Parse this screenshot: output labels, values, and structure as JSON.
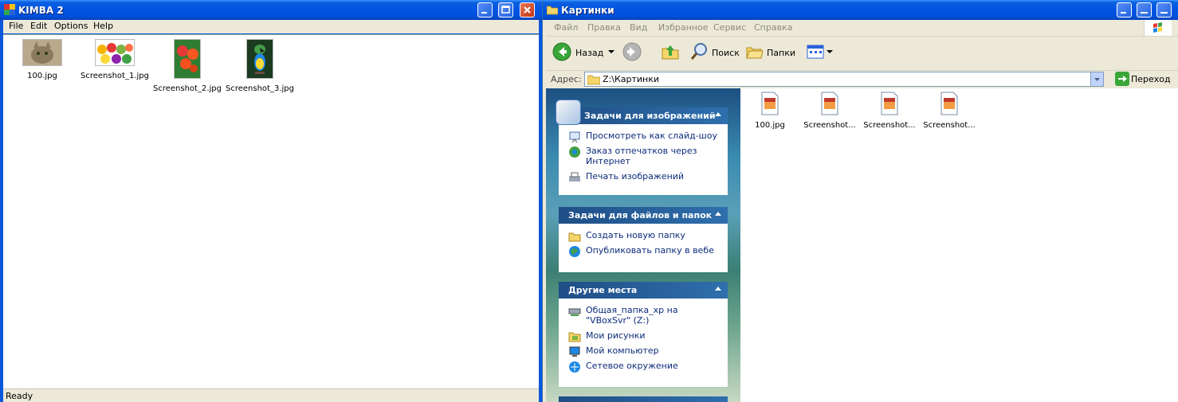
{
  "kimba": {
    "title": "KIMBA 2",
    "menu": [
      "File",
      "Edit",
      "Options",
      "Help"
    ],
    "thumbnails": [
      {
        "label": "100.jpg",
        "icon": "cat-photo"
      },
      {
        "label": "Screenshot_1.jpg",
        "icon": "fruit-photo"
      },
      {
        "label": "Screenshot_2.jpg",
        "icon": "flowers-photo"
      },
      {
        "label": "Screenshot_3.jpg",
        "icon": "parrot-photo"
      }
    ],
    "status": "Ready"
  },
  "explorer": {
    "title": "Картинки",
    "menu": [
      "Файл",
      "Правка",
      "Вид",
      "Избранное",
      "Сервис",
      "Справка"
    ],
    "toolbar": {
      "back": "Назад",
      "search": "Поиск",
      "folders": "Папки"
    },
    "address": {
      "label": "Адрес:",
      "value": "Z:\\Картинки",
      "go": "Переход"
    },
    "panels": [
      {
        "title": "Задачи для изображений",
        "tasks": [
          {
            "label": "Просмотреть как слайд-шоу",
            "icon": "slideshow-icon"
          },
          {
            "label": "Заказ отпечатков через Интернет",
            "icon": "order-prints-icon"
          },
          {
            "label": "Печать изображений",
            "icon": "print-icon"
          }
        ]
      },
      {
        "title": "Задачи для файлов и папок",
        "tasks": [
          {
            "label": "Создать новую папку",
            "icon": "new-folder-icon"
          },
          {
            "label": "Опубликовать папку в вебе",
            "icon": "publish-web-icon"
          }
        ]
      },
      {
        "title": "Другие места",
        "tasks": [
          {
            "label": "Общая_папка_xp на \"VBoxSvr\" (Z:)",
            "icon": "network-drive-icon"
          },
          {
            "label": "Мои рисунки",
            "icon": "my-pictures-icon"
          },
          {
            "label": "Мой компьютер",
            "icon": "my-computer-icon"
          },
          {
            "label": "Сетевое окружение",
            "icon": "network-places-icon"
          }
        ]
      }
    ],
    "files": [
      {
        "name": "100.jpg"
      },
      {
        "name": "Screenshot..."
      },
      {
        "name": "Screenshot..."
      },
      {
        "name": "Screenshot..."
      }
    ]
  },
  "colors": {
    "xp_titlebar": "#0054e3",
    "panel_header": "#1f4e86",
    "task_link": "#0c2b7a"
  }
}
